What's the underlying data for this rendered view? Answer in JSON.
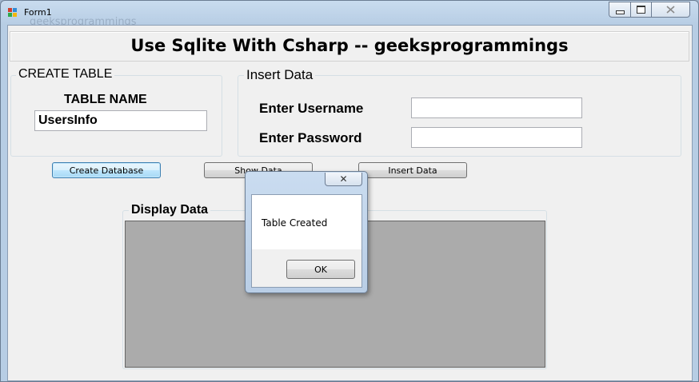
{
  "window": {
    "title": "Form1",
    "ghost_title": "geeksprogrammings"
  },
  "header": {
    "title": "Use Sqlite With Csharp -- geeksprogrammings"
  },
  "create_table": {
    "group_label": "CREATE TABLE",
    "table_name_label": "TABLE NAME",
    "table_name_value": "UsersInfo"
  },
  "insert_data": {
    "group_label": "Insert Data",
    "username_label": "Enter Username",
    "username_value": "",
    "password_label": "Enter Password",
    "password_value": ""
  },
  "buttons": {
    "create_database": "Create Database",
    "show_data": "Show Data",
    "insert_data": "Insert Data"
  },
  "display": {
    "group_label": "Display Data"
  },
  "dialog": {
    "message": "Table Created",
    "ok_label": "OK",
    "close_glyph": "✕"
  },
  "colors": {
    "grid_background": "#ababab",
    "focus_border": "#3c7fb1"
  }
}
